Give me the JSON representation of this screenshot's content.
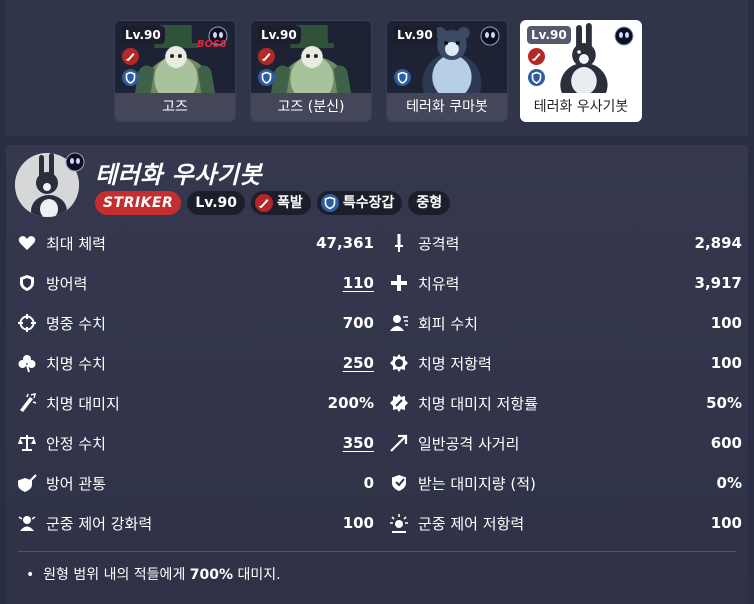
{
  "cards": [
    {
      "level": "Lv.90",
      "name": "고즈",
      "boss": "BOSS"
    },
    {
      "level": "Lv.90",
      "name": "고즈 (분신)"
    },
    {
      "level": "Lv.90",
      "name": "테러화 쿠마봇"
    },
    {
      "level": "Lv.90",
      "name": "테러화 우사기봇",
      "selected": true
    }
  ],
  "character": {
    "name": "테러화 우사기봇",
    "tags": {
      "role": "STRIKER",
      "level": "Lv.90",
      "attack_type": "폭발",
      "armor_type": "특수장갑",
      "size": "중형"
    }
  },
  "stats_left": [
    {
      "icon": "heart-icon",
      "label": "최대 체력",
      "value": "47,361",
      "underline": false
    },
    {
      "icon": "shield-icon",
      "label": "방어력",
      "value": "110",
      "underline": true
    },
    {
      "icon": "crosshair-icon",
      "label": "명중 수치",
      "value": "700",
      "underline": false
    },
    {
      "icon": "clover-icon",
      "label": "치명 수치",
      "value": "250",
      "underline": true
    },
    {
      "icon": "critical-damage-icon",
      "label": "치명 대미지",
      "value": "200%",
      "underline": false
    },
    {
      "icon": "scales-icon",
      "label": "안정 수치",
      "value": "350",
      "underline": true
    },
    {
      "icon": "armor-pierce-icon",
      "label": "방어 관통",
      "value": "0",
      "underline": false
    },
    {
      "icon": "cc-power-icon",
      "label": "군중 제어 강화력",
      "value": "100",
      "underline": false
    }
  ],
  "stats_right": [
    {
      "icon": "sword-icon",
      "label": "공격력",
      "value": "2,894",
      "underline": false
    },
    {
      "icon": "plus-icon",
      "label": "치유력",
      "value": "3,917",
      "underline": false
    },
    {
      "icon": "dodge-icon",
      "label": "회피 수치",
      "value": "100",
      "underline": false
    },
    {
      "icon": "crit-resist-icon",
      "label": "치명 저항력",
      "value": "100",
      "underline": false
    },
    {
      "icon": "crit-damage-resist-icon",
      "label": "치명 대미지 저항률",
      "value": "50%",
      "underline": false
    },
    {
      "icon": "range-arrow-icon",
      "label": "일반공격 사거리",
      "value": "600",
      "underline": false
    },
    {
      "icon": "damage-taken-icon",
      "label": "받는 대미지량 (적)",
      "value": "0%",
      "underline": false
    },
    {
      "icon": "cc-resist-icon",
      "label": "군중 제어 저항력",
      "value": "100",
      "underline": false
    }
  ],
  "description": {
    "prefix": "원형 범위 내의 적들에게 ",
    "highlight": "700%",
    "suffix": " 대미지."
  },
  "colors": {
    "background": "#2a2e45",
    "striker": "#c42e2e",
    "explosive": "#b52828",
    "special_armor": "#2c5d9e"
  }
}
